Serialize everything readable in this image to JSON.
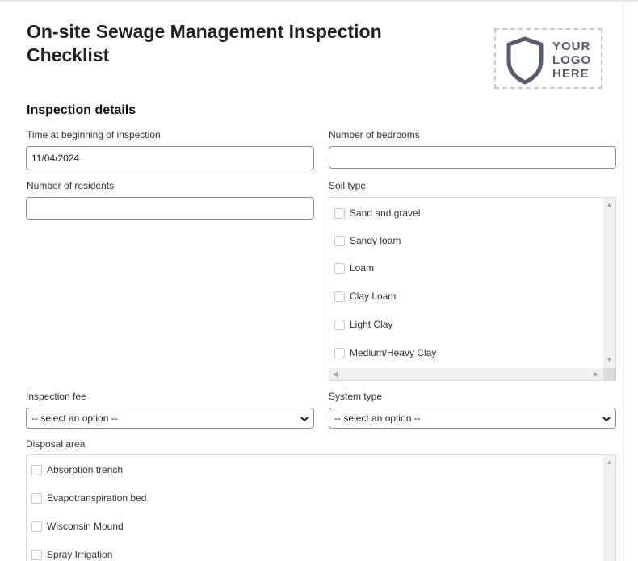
{
  "title": "On-site Sewage Management Inspection Checklist",
  "logo": {
    "line1": "YOUR",
    "line2": "LOGO",
    "line3": "HERE",
    "icon": "shield-icon"
  },
  "section": "Inspection details",
  "fields": {
    "time_label": "Time at beginning of inspection",
    "time_value": "11/04/2024",
    "bedrooms_label": "Number of bedrooms",
    "bedrooms_value": "",
    "residents_label": "Number of residents",
    "residents_value": "",
    "soil_label": "Soil type",
    "soil_options": [
      "Sand and gravel",
      "Sandy loam",
      "Loam",
      "Clay Loam",
      "Light Clay",
      "Medium/Heavy Clay"
    ],
    "fee_label": "Inspection fee",
    "fee_value": "-- select an option --",
    "system_label": "System type",
    "system_value": "-- select an option --",
    "disposal_label": "Disposal area",
    "disposal_options": [
      "Absorption trench",
      "Evapotranspiration bed",
      "Wisconsin Mound",
      "Spray Irrigation"
    ]
  },
  "colors": {
    "border": "#8f8f95",
    "logo": "#555c6e"
  }
}
